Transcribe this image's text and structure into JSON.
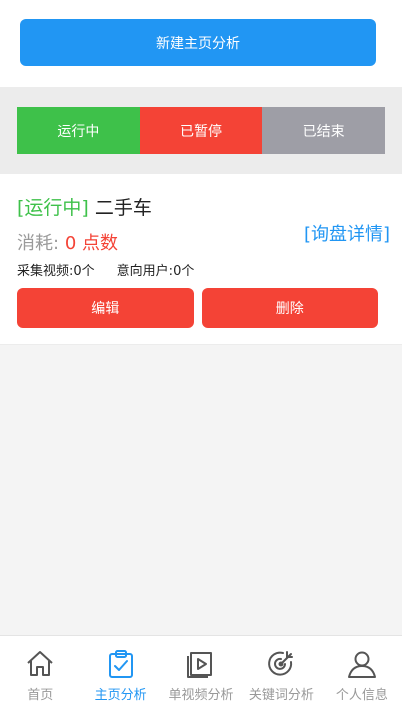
{
  "header": {
    "new_button_label": "新建主页分析"
  },
  "filter_tabs": [
    {
      "label": "运行中",
      "color": "#3ec14a"
    },
    {
      "label": "已暂停",
      "color": "#f44336"
    },
    {
      "label": "已结束",
      "color": "#9e9ea6"
    }
  ],
  "task_card": {
    "status": "[运行中]",
    "name": "二手车",
    "cost_label": "消耗:",
    "cost_value": "0 点数",
    "detail_link": "[询盘详情]",
    "videos_label": "采集视频:",
    "videos_value": "0个",
    "users_label": "意向用户:",
    "users_value": "0个",
    "edit_label": "编辑",
    "delete_label": "删除"
  },
  "tabbar": {
    "items": [
      {
        "label": "首页",
        "icon": "home-icon"
      },
      {
        "label": "主页分析",
        "icon": "clipboard-check-icon",
        "active": true
      },
      {
        "label": "单视频分析",
        "icon": "video-icon"
      },
      {
        "label": "关键词分析",
        "icon": "target-icon"
      },
      {
        "label": "个人信息",
        "icon": "user-icon"
      }
    ]
  },
  "colors": {
    "primary": "#2196f3",
    "success": "#3ec14a",
    "danger": "#f44336",
    "muted": "#9e9ea6"
  }
}
